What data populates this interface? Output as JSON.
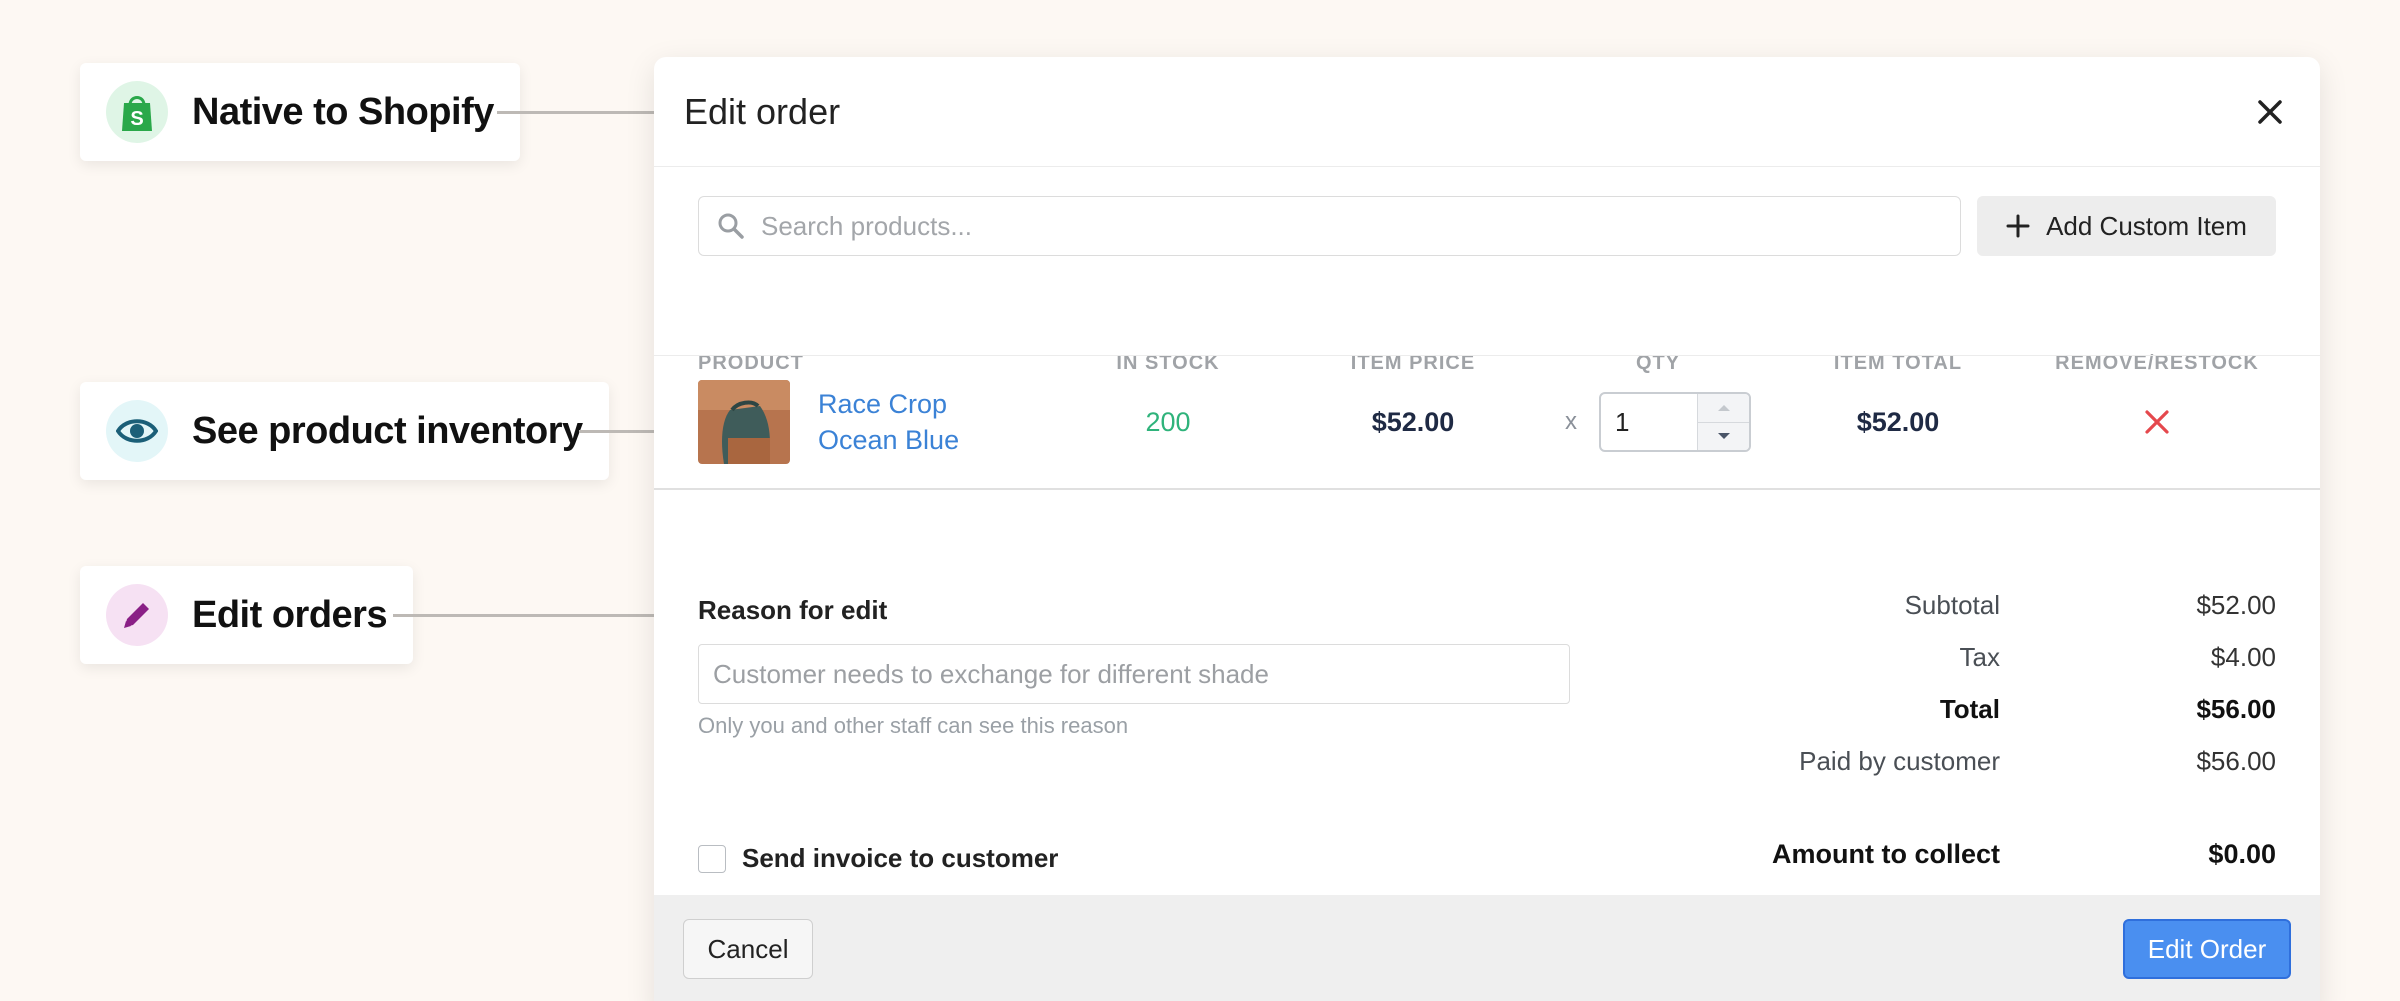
{
  "callouts": [
    {
      "label": "Native to Shopify",
      "icon": "shopify-bag-icon",
      "badge_color": "#dff5e6",
      "icon_color": "#2aa84a"
    },
    {
      "label": "See product inventory",
      "icon": "eye-icon",
      "badge_color": "#e3f6f8",
      "icon_color": "#1b5f78"
    },
    {
      "label": "Edit orders",
      "icon": "pencil-icon",
      "badge_color": "#f6e1f3",
      "icon_color": "#8a1f86"
    }
  ],
  "modal": {
    "title": "Edit order",
    "search": {
      "placeholder": "Search products...",
      "value": ""
    },
    "add_custom_label": "Add Custom Item",
    "columns": [
      "PRODUCT",
      "IN STOCK",
      "ITEM PRICE",
      "QTY",
      "ITEM TOTAL",
      "REMOVE/RESTOCK"
    ],
    "line_item": {
      "name_line1": "Race Crop",
      "name_line2": "Ocean Blue",
      "in_stock": "200",
      "item_price": "$52.00",
      "qty_prefix": "x",
      "qty": "1",
      "item_total": "$52.00"
    },
    "reason": {
      "label": "Reason for edit",
      "placeholder": "Customer needs to exchange for different shade",
      "hint": "Only you and other staff can see this reason"
    },
    "summary": {
      "subtotal_label": "Subtotal",
      "subtotal": "$52.00",
      "tax_label": "Tax",
      "tax": "$4.00",
      "total_label": "Total",
      "total": "$56.00",
      "paid_label": "Paid by customer",
      "paid": "$56.00"
    },
    "invoice_label": "Send invoice to customer",
    "collect_label": "Amount to collect",
    "collect_value": "$0.00",
    "cancel_label": "Cancel",
    "submit_label": "Edit Order"
  },
  "colors": {
    "accent": "#4a8ff0",
    "link": "#3b82d6",
    "stock": "#2fb37b",
    "danger": "#e5484d"
  }
}
